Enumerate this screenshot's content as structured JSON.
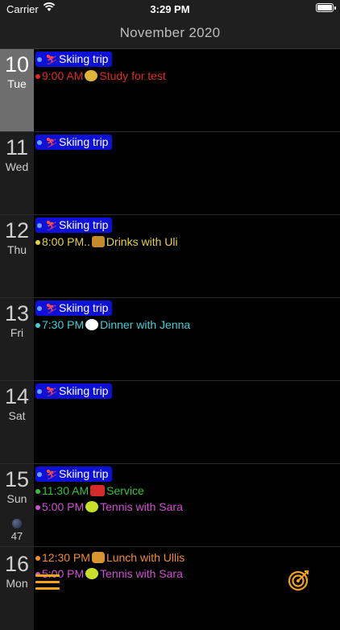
{
  "status": {
    "carrier": "Carrier",
    "time": "3:29 PM"
  },
  "header": {
    "month": "November 2020"
  },
  "colors": {
    "allday": "#0d10d6",
    "red": "#e02a2a",
    "yellow": "#e6d23a",
    "cyan": "#3fcfd6",
    "green": "#36c43a",
    "magenta": "#d34fd3",
    "orange": "#f28c2a",
    "accent": "#f2a21b"
  },
  "days": [
    {
      "num": "10",
      "dow": "Tue",
      "allday": "Skiing trip",
      "events": [
        {
          "time": "9:00 AM",
          "title": "Study for test",
          "icon": "nerd-face-icon",
          "color": "#e02a2a"
        }
      ]
    },
    {
      "num": "11",
      "dow": "Wed",
      "allday": "Skiing trip",
      "events": []
    },
    {
      "num": "12",
      "dow": "Thu",
      "allday": "Skiing trip",
      "events": [
        {
          "time": "8:00 PM..",
          "title": "Drinks with Uli",
          "icon": "beer-mugs-icon",
          "color": "#e6d23a"
        }
      ]
    },
    {
      "num": "13",
      "dow": "Fri",
      "allday": "Skiing trip",
      "events": [
        {
          "time": "7:30 PM",
          "title": "Dinner with Jenna",
          "icon": "plate-cutlery-icon",
          "color": "#3fcfd6"
        }
      ]
    },
    {
      "num": "14",
      "dow": "Sat",
      "allday": "Skiing trip",
      "events": []
    },
    {
      "num": "15",
      "dow": "Sun",
      "allday": "Skiing trip",
      "week": "47",
      "events": [
        {
          "time": "11:30 AM",
          "title": "Service",
          "icon": "car-icon",
          "color": "#36c43a"
        },
        {
          "time": "5:00 PM",
          "title": "Tennis with Sara",
          "icon": "tennis-ball-icon",
          "color": "#d34fd3"
        }
      ]
    },
    {
      "num": "16",
      "dow": "Mon",
      "events": [
        {
          "time": "12:30 PM",
          "title": "Lunch with Ullis",
          "icon": "burger-icon",
          "color": "#f28c2a"
        },
        {
          "time": "5:00 PM",
          "title": "Tennis with Sara",
          "icon": "tennis-ball-icon",
          "color": "#d34fd3"
        }
      ]
    }
  ]
}
